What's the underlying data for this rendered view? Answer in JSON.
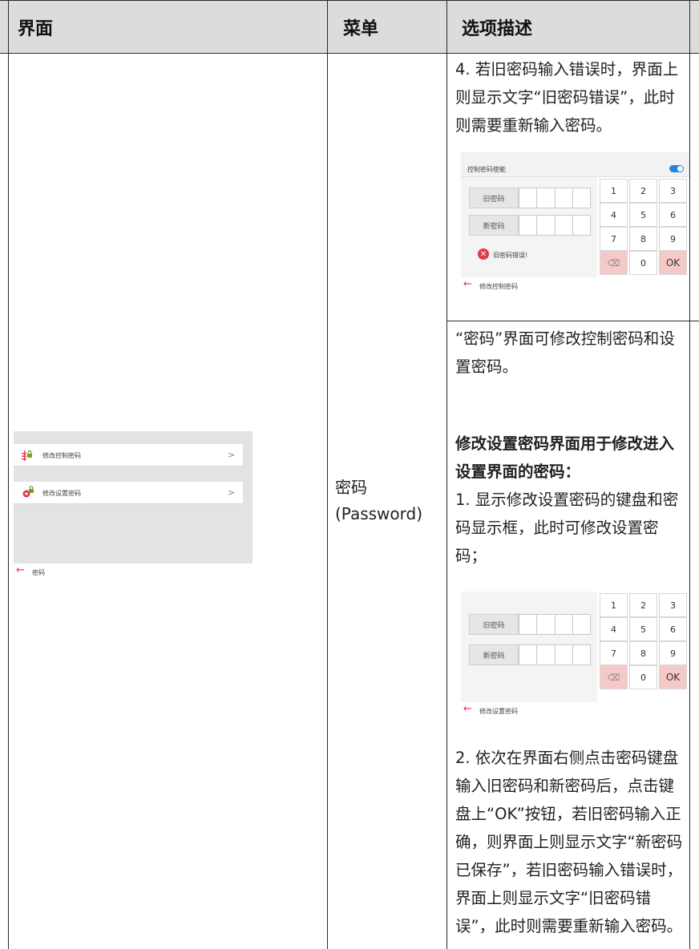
{
  "header": {
    "col1": "界面",
    "col2": "菜单",
    "col3": "选项描述"
  },
  "menu": {
    "name": "密码",
    "english": "(Password)"
  },
  "left_screen": {
    "items": [
      {
        "label": "修改控制密码",
        "icon": "control-lock-icon"
      },
      {
        "label": "修改设置密码",
        "icon": "settings-lock-icon"
      }
    ],
    "chevron": ">",
    "back_label": "密码"
  },
  "desc": {
    "p1": "4. 若旧密码输入错误时，界面上则显示文字“旧密码错误”，此时则需要重新输入密码。",
    "p2": "“密码”界面可修改控制密码和设置密码。",
    "p3_heading": "修改设置密码界面用于修改进入设置界面的密码：",
    "p3_body": "1. 显示修改设置密码的键盘和密码显示框，此时可修改设置密码；",
    "p4": "2. 依次在界面右侧点击密码键盘输入旧密码和新密码后，点击键盘上“OK”按钮，若旧密码输入正确，则界面上则显示文字“新密码已保存”，若旧密码输入错误时，界面上则显示文字“旧密码错误”，此时则需要重新输入密码。"
  },
  "screen1": {
    "toggle_title": "控制密码使能",
    "old_label": "旧密码",
    "new_label": "新密码",
    "error_text": "旧密码错误!",
    "back_label": "修改控制密码"
  },
  "screen2": {
    "old_label": "旧密码",
    "new_label": "新密码",
    "back_label": "修改设置密码"
  },
  "keypad": {
    "keys": [
      "1",
      "2",
      "3",
      "4",
      "5",
      "6",
      "7",
      "8",
      "9",
      "⌫",
      "0",
      "OK"
    ]
  },
  "colors": {
    "accent_red": "#e0394a",
    "toggle_blue": "#1e88e5",
    "pink_key": "#f6c9c9"
  }
}
